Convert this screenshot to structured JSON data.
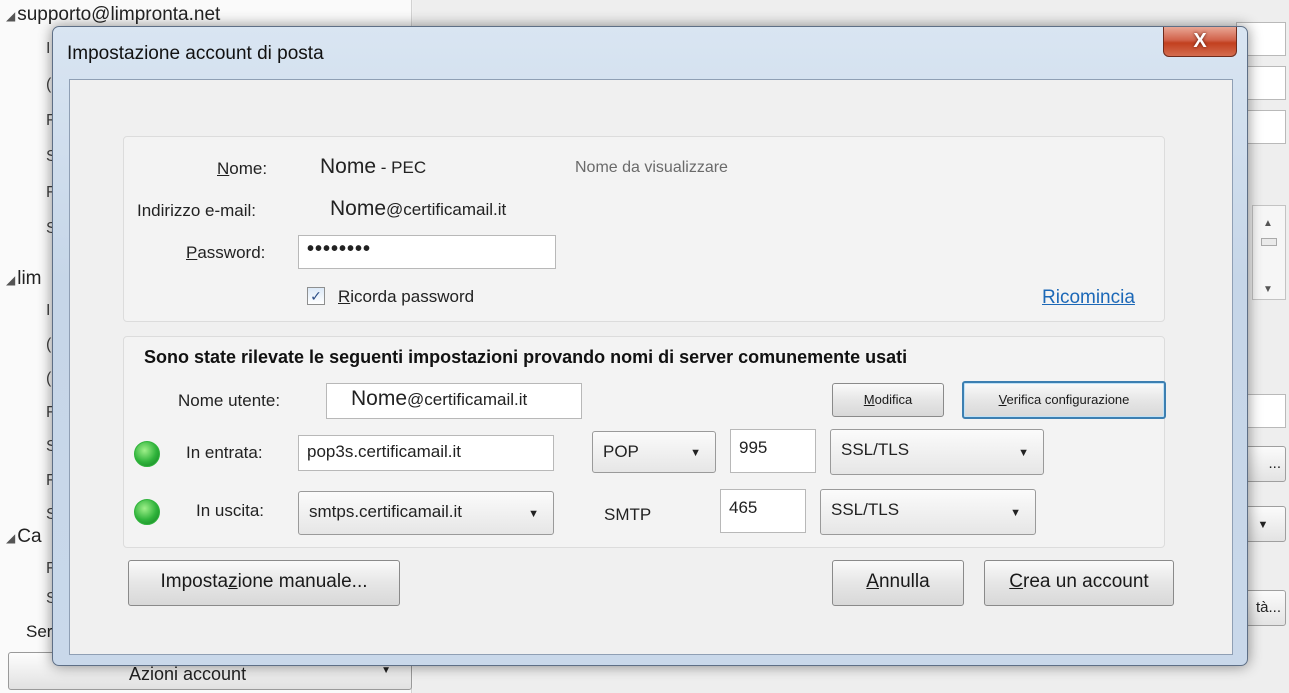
{
  "background": {
    "tree": [
      {
        "label": "supporto@limpronta.net"
      },
      {
        "label": "lim"
      },
      {
        "label": "Ca"
      }
    ],
    "partial_label_ser": "Ser",
    "right_btn_1": "...",
    "right_btn_3": "tà...",
    "bottom_button": "Azioni account"
  },
  "dialog": {
    "title": "Impostazione account di posta",
    "close_label": "X",
    "name": {
      "label": "Nome:",
      "value": "Nome",
      "suffix": " - PEC",
      "hint": "Nome da visualizzare"
    },
    "email": {
      "label": "Indirizzo e-mail:",
      "value": "Nome",
      "domain": "@certificamail.it"
    },
    "password": {
      "label": "Password:",
      "masked": "••••••••"
    },
    "remember": {
      "label": "Ricorda password",
      "checked": true,
      "mark": "✓"
    },
    "restart_link": "Ricomincia",
    "detected_heading": "Sono state rilevate le seguenti impostazioni provando nomi di server comunemente usati",
    "username": {
      "label": "Nome utente:",
      "value": "Nome",
      "domain": "@certificamail.it"
    },
    "modify_button": "Modifica",
    "verify_button": "Verifica configurazione",
    "incoming": {
      "label": "In entrata:",
      "server": "pop3s.certificamail.it",
      "protocol": "POP",
      "port": "995",
      "security": "SSL/TLS",
      "status_color": "#2fb33b"
    },
    "outgoing": {
      "label": "In uscita:",
      "server": "smtps.certificamail.it",
      "protocol": "SMTP",
      "port": "465",
      "security": "SSL/TLS",
      "status_color": "#2fb33b"
    },
    "manual_button": "Impostazione manuale...",
    "cancel_button": "Annulla",
    "create_button": "Crea un account"
  }
}
